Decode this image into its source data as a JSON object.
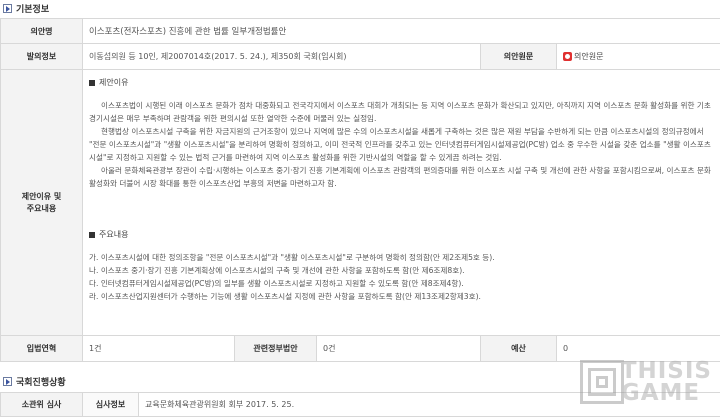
{
  "basic_info": {
    "title": "기본정보",
    "bill_name_label": "의안명",
    "bill_name": "이스포츠(전자스포츠) 진흥에 관한 법률 일부개정법률안",
    "proposer_label": "발의정보",
    "proposer": "이동섭의원 등 10인, 제2007014호(2017. 5. 24.), 제350회 국회(임시회)",
    "original_label": "의안원문",
    "original_link": "의안원문",
    "reason_label": "제안이유 및\n주요내용",
    "reason_heading": "제안이유",
    "reason_paragraphs": [
      "이스포츠법이 시행된 이래 이스포츠 문화가 점차 대중화되고 전국각지에서 이스포츠 대회가 개최되는 등 지역 이스포츠 문화가 확산되고 있지만, 아직까지 지역 이스포츠 문화 활성화를 위한 기초 경기시설은 매우 부족하며 관람객을 위한 편의시설 또한 열악한 수준에 머물러 있는 실정임.",
      "현행법상 이스포츠시설 구축을 위한 자금지원의 근거조항이 있으나 지역에 많은 수의 이스포츠시설을 새롭게 구축하는 것은 많은 재원 부담을 수반하게 되는 만큼 이스포츠시설의 정의규정에서 \"전문 이스포츠시설\"과 \"생활 이스포츠시설\"을 분리하여 명확히 정의하고, 이미 전국적 인프라를 갖추고 있는 인터넷컴퓨터게임시설제공업(PC방) 업소 중 우수한 시설을 갖춘 업소를 \"생활 이스포츠시설\"로 지정하고 지원할 수 있는 법적 근거를 마련하여 지역 이스포츠 활성화를 위한 기반시설의 역할을 할 수 있게끔 하려는 것임.",
      "아울러 문화체육관광부 장관이 수립·시행하는 이스포츠 중기·장기 진흥 기본계획에 이스포츠 관람객의 편의증대를 위한 이스포츠 시설 구축 및 개선에 관한 사항을 포함시킴으로써, 이스포츠 문화 활성화와 더불어 시장 확대를 통한 이스포츠산업 부흥의 저변을 마련하고자 함."
    ],
    "main_heading": "주요내용",
    "main_items": [
      "가. 이스포츠시설에 대한 정의조항을 \"전문 이스포츠시설\"과 \"생활 이스포츠시설\"로 구분하여 명확히 정의함(안 제2조제5호 등).",
      "나. 이스포츠 중기·장기 진흥 기본계획상에 이스포츠시설의 구축 및 개선에 관한 사항을 포함하도록 함(안 제6조제8호).",
      "다. 인터넷컴퓨터게임시설제공업(PC방)의 일부를 생활 이스포츠시설로 지정하고 지원할 수 있도록 함(안 제8조제4항).",
      "라. 이스포츠산업지원센터가 수행하는 기능에 생활 이스포츠시설 지정에 관한 사항을 포함하도록 함(안 제13조제2항제3호)."
    ],
    "history_label": "입법연혁",
    "history_value": "1건",
    "related_label": "관련정부법안",
    "related_value": "0건",
    "budget_label": "예산",
    "budget_value": "0"
  },
  "progress": {
    "title": "국회진행상황",
    "committee_label": "소관위 심사",
    "review_label": "심사정보",
    "review_value": "교육문화체육관광위원회 회부 2017. 5. 25."
  },
  "watermark": {
    "line1": "THISIS",
    "line2": "GAME"
  }
}
